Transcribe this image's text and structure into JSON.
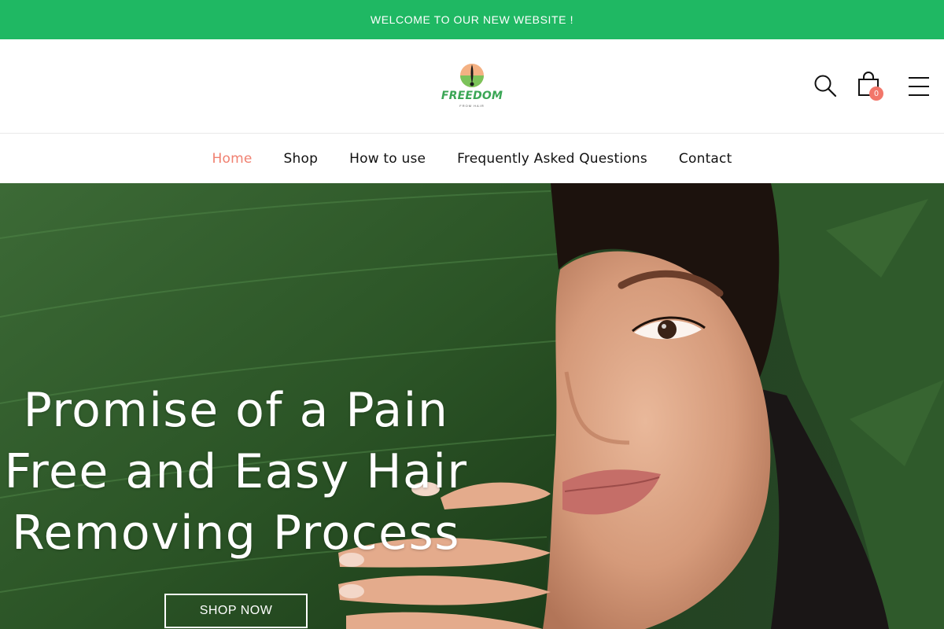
{
  "announcement": {
    "text": "WELCOME TO OUR NEW WEBSITE !"
  },
  "header": {
    "logo": {
      "word": "FREEDOM",
      "tagline": "FROM HAIR"
    },
    "icons": {
      "search": "search-icon",
      "cart": "shopping-bag-icon",
      "menu": "hamburger-menu-icon"
    },
    "cart_count": "0"
  },
  "nav": {
    "items": [
      {
        "label": "Home",
        "active": true
      },
      {
        "label": "Shop",
        "active": false
      },
      {
        "label": "How to use",
        "active": false
      },
      {
        "label": "Frequently Asked Questions",
        "active": false
      },
      {
        "label": "Contact",
        "active": false
      }
    ]
  },
  "hero": {
    "title_lines": [
      "Promise of a Pain",
      "Free and Easy Hair",
      "Removing Process"
    ],
    "button_label": "SHOP NOW"
  },
  "colors": {
    "announcement_bg": "#1fb863",
    "nav_active": "#f08070",
    "cart_badge": "#f2766a",
    "logo_green": "#3aa655",
    "logo_peach": "#f4b183"
  }
}
